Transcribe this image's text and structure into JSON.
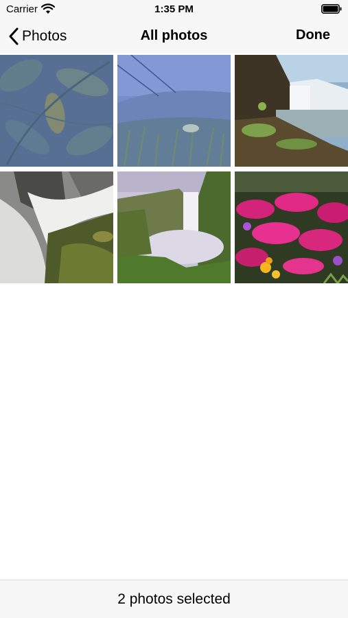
{
  "status_bar": {
    "carrier": "Carrier",
    "time": "1:35 PM",
    "icons": [
      "wifi-icon",
      "battery-icon"
    ]
  },
  "nav_bar": {
    "back_label": "Photos",
    "back_icon": "chevron-left-icon",
    "title": "All photos",
    "done_label": "Done"
  },
  "photos": [
    {
      "subject": "leaves"
    },
    {
      "subject": "hillside-grass"
    },
    {
      "subject": "waterfall-coast"
    },
    {
      "subject": "waterfall-rocks"
    },
    {
      "subject": "waterfall-mist"
    },
    {
      "subject": "pink-flowers"
    }
  ],
  "toolbar": {
    "selection_text": "2 photos selected"
  },
  "colors": {
    "bar_background": "#f7f7f7",
    "tint": "#000000",
    "background": "#ffffff"
  }
}
